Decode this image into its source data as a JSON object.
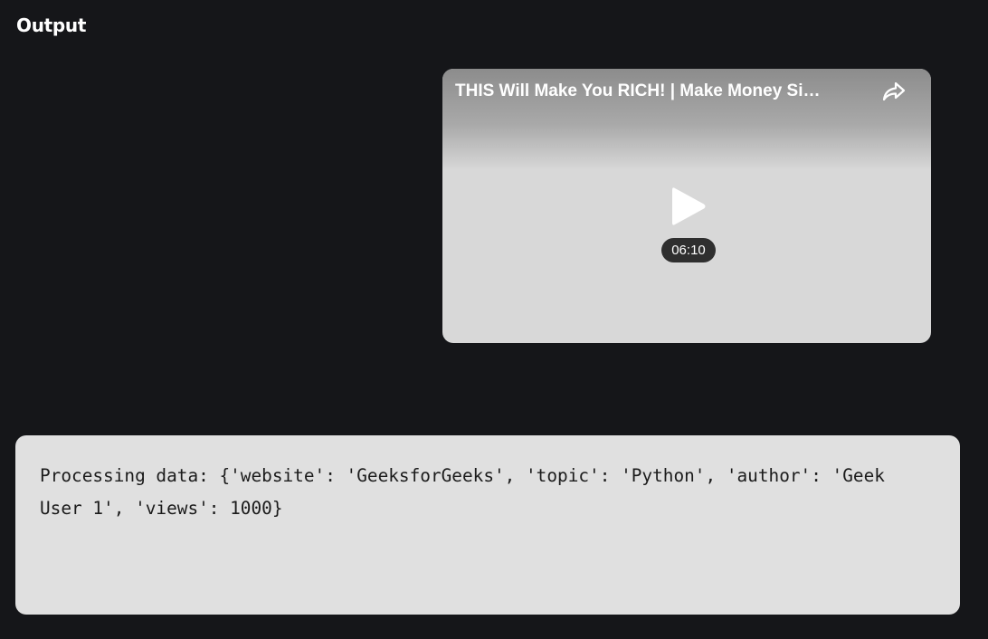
{
  "section": {
    "title": "Output"
  },
  "video": {
    "title": "THIS Will Make You RICH! | Make Money Si…",
    "duration": "06:10",
    "share_icon": "share-arrow-icon",
    "play_icon": "play-icon"
  },
  "output": {
    "text": "Processing data: {'website': 'GeeksforGeeks', 'topic': 'Python', 'author': 'Geek User 1', 'views': 1000}"
  },
  "colors": {
    "page_background": "#151619",
    "output_background": "#e0e0e0",
    "video_background": "#d8d8d8",
    "duration_badge": "#2f2f2f"
  }
}
